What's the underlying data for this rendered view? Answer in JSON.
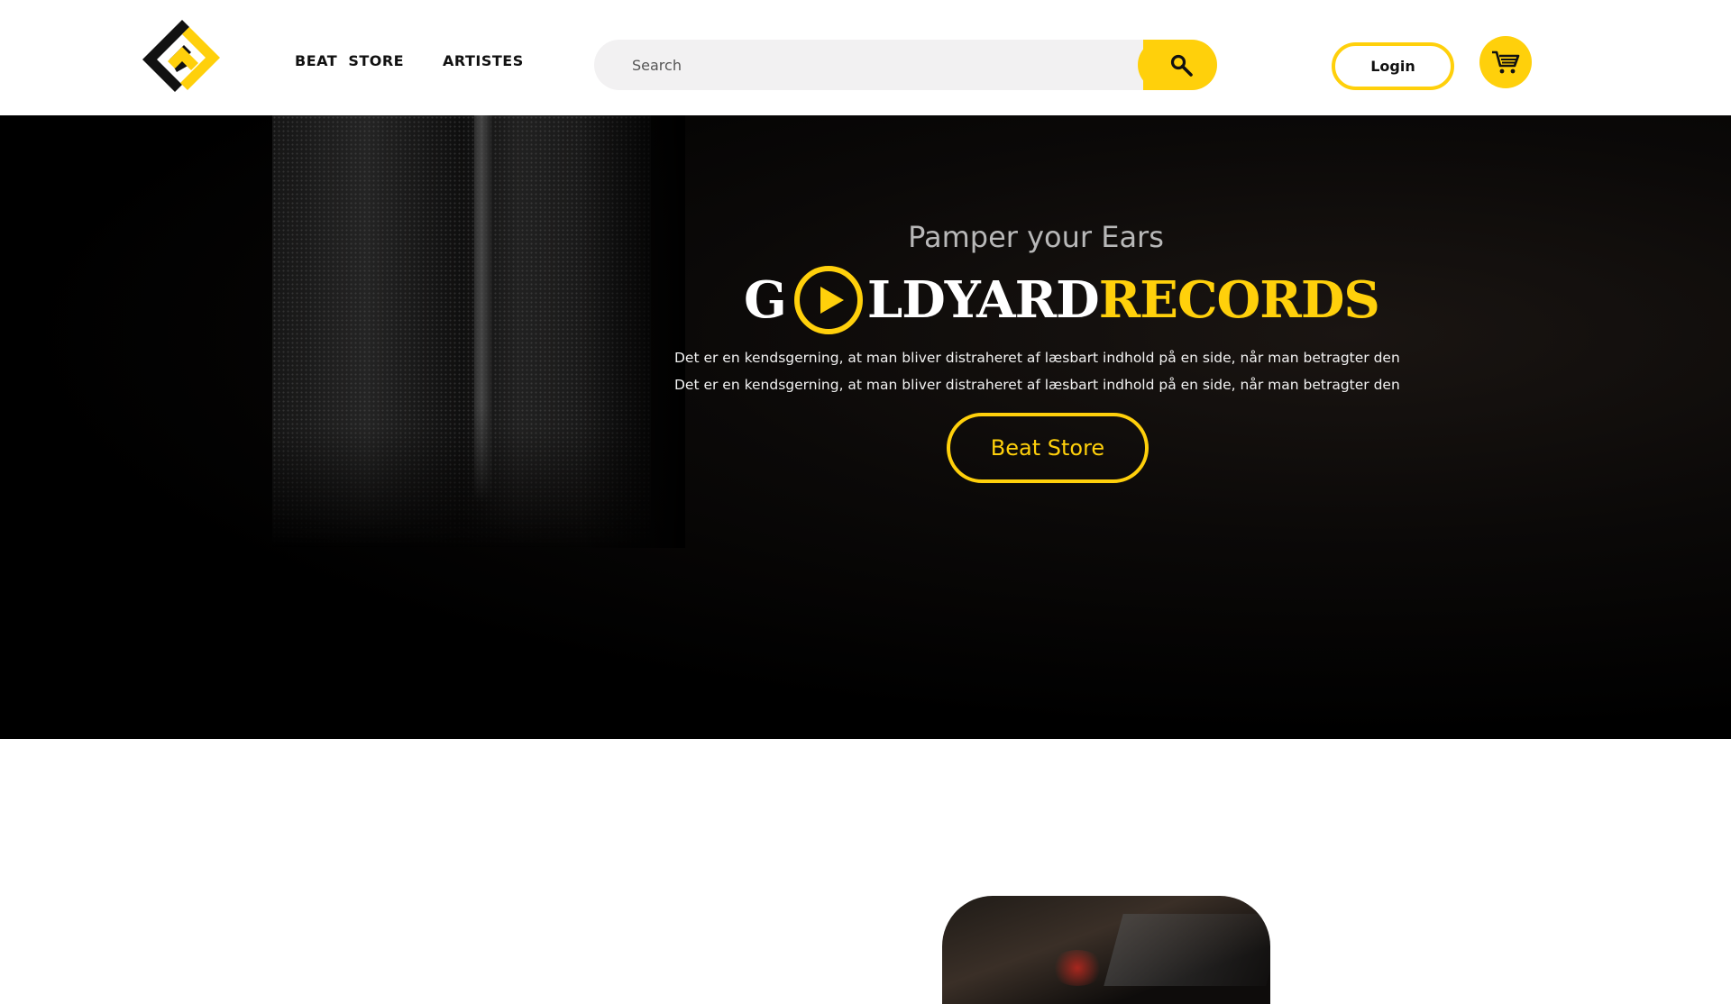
{
  "header": {
    "nav": {
      "beat_store": "BEAT  STORE",
      "artists": "ARTISTES"
    },
    "search": {
      "placeholder": "Search",
      "icon": "search-icon"
    },
    "login_label": "Login",
    "cart_icon": "cart-icon",
    "logo": "goldyard-logo"
  },
  "hero": {
    "tagline": "Pamper your Ears",
    "brand": {
      "part1": "G",
      "part2": "LDYARD",
      "part3": "RECORDS"
    },
    "description": [
      "Det er en kendsgerning, at man bliver distraheret af læsbart indhold på en side, når man betragter den",
      "Det er en kendsgerning, at man bliver distraheret af læsbart indhold på en side, når man betragter den"
    ],
    "cta_label": "Beat Store"
  },
  "colors": {
    "accent": "#ffd00b",
    "dark": "#000000",
    "light": "#ffffff"
  }
}
